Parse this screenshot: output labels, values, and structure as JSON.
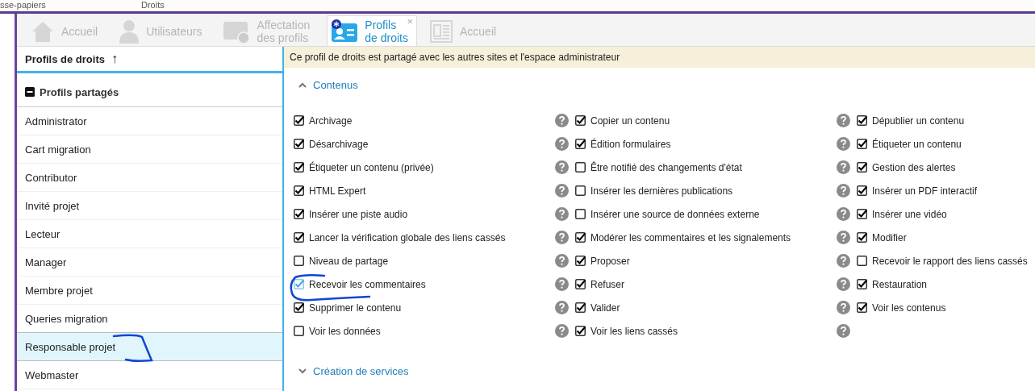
{
  "top_strip": {
    "labels": [
      "sse-papiers",
      "Droits"
    ]
  },
  "tabs": [
    {
      "label": "Accueil",
      "kind": "house",
      "selected": false
    },
    {
      "label": "Utilisateurs",
      "kind": "person",
      "selected": false
    },
    {
      "label": "Affectation\ndes profils",
      "kind": "card-pen",
      "selected": false
    },
    {
      "label": "Profils\nde droits",
      "kind": "card-star",
      "selected": true,
      "close": "×"
    },
    {
      "label": "Accueil",
      "kind": "document",
      "selected": false
    }
  ],
  "profile_list": {
    "title": "Profils de droits",
    "sort_arrow": "↑",
    "group": {
      "title": "Profils partagés",
      "expanded": true
    },
    "items": [
      {
        "label": "Administrator",
        "selected": false
      },
      {
        "label": "Cart migration",
        "selected": false
      },
      {
        "label": "Contributor",
        "selected": false
      },
      {
        "label": "Invité projet",
        "selected": false
      },
      {
        "label": "Lecteur",
        "selected": false
      },
      {
        "label": "Manager",
        "selected": false
      },
      {
        "label": "Membre projet",
        "selected": false
      },
      {
        "label": "Queries migration",
        "selected": false
      },
      {
        "label": "Responsable projet",
        "selected": true
      },
      {
        "label": "Webmaster",
        "selected": false
      }
    ]
  },
  "banner": "Ce profil de droits est partagé avec les autres sites et l'espace administrateur",
  "sections": [
    {
      "title": "Contenus",
      "expanded": true,
      "columns": [
        [
          {
            "label": "Archivage",
            "checked": true,
            "highlighted": false
          },
          {
            "label": "Désarchivage",
            "checked": true,
            "highlighted": false
          },
          {
            "label": "Étiqueter un contenu (privée)",
            "checked": true,
            "highlighted": false
          },
          {
            "label": "HTML Expert",
            "checked": true,
            "highlighted": false
          },
          {
            "label": "Insérer une piste audio",
            "checked": true,
            "highlighted": false
          },
          {
            "label": "Lancer la vérification globale des liens cassés",
            "checked": true,
            "highlighted": false
          },
          {
            "label": "Niveau de partage",
            "checked": false,
            "highlighted": false
          },
          {
            "label": "Recevoir les commentaires",
            "checked": true,
            "highlighted": true
          },
          {
            "label": "Supprimer le contenu",
            "checked": true,
            "highlighted": false
          },
          {
            "label": "Voir les données",
            "checked": false,
            "highlighted": false
          }
        ],
        [
          {
            "label": "Copier un contenu",
            "checked": true,
            "highlighted": false
          },
          {
            "label": "Édition formulaires",
            "checked": true,
            "highlighted": false
          },
          {
            "label": "Être notifié des changements d'état",
            "checked": false,
            "highlighted": false
          },
          {
            "label": "Insérer les dernières publications",
            "checked": false,
            "highlighted": false
          },
          {
            "label": "Insérer une source de données externe",
            "checked": false,
            "highlighted": false
          },
          {
            "label": "Modérer les commentaires et les signalements",
            "checked": true,
            "highlighted": false
          },
          {
            "label": "Proposer",
            "checked": true,
            "highlighted": false
          },
          {
            "label": "Refuser",
            "checked": true,
            "highlighted": false
          },
          {
            "label": "Valider",
            "checked": true,
            "highlighted": false
          },
          {
            "label": "Voir les liens cassés",
            "checked": true,
            "highlighted": false
          }
        ],
        [
          {
            "label": "Dépublier un contenu",
            "checked": true,
            "highlighted": false
          },
          {
            "label": "Étiqueter un contenu",
            "checked": true,
            "highlighted": false
          },
          {
            "label": "Gestion des alertes",
            "checked": true,
            "highlighted": false
          },
          {
            "label": "Insérer un PDF interactif",
            "checked": true,
            "highlighted": false
          },
          {
            "label": "Insérer une vidéo",
            "checked": true,
            "highlighted": false
          },
          {
            "label": "Modifier",
            "checked": true,
            "highlighted": false
          },
          {
            "label": "Recevoir le rapport des liens cassés",
            "checked": false,
            "highlighted": false
          },
          {
            "label": "Restauration",
            "checked": true,
            "highlighted": false
          },
          {
            "label": "Voir les contenus",
            "checked": true,
            "highlighted": false
          }
        ]
      ]
    },
    {
      "title": "Création de services",
      "expanded": false
    }
  ]
}
